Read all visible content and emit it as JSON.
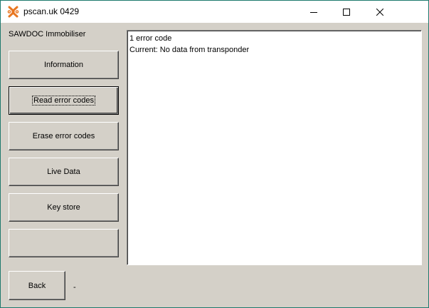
{
  "window": {
    "title": "pscan.uk 0429"
  },
  "panel": {
    "heading": "SAWDOC Immobiliser",
    "buttons": [
      {
        "label": "Information"
      },
      {
        "label": "Read error codes"
      },
      {
        "label": "Erase error codes"
      },
      {
        "label": "Live Data"
      },
      {
        "label": "Key store"
      },
      {
        "label": ""
      }
    ],
    "back_label": "Back",
    "status_text": "-"
  },
  "output": {
    "lines": [
      "1 error code",
      "Current: No data from transponder"
    ]
  },
  "colors": {
    "face": "#d4d0c8",
    "window_border": "#1e7a6e",
    "icon_orange": "#e87722"
  }
}
